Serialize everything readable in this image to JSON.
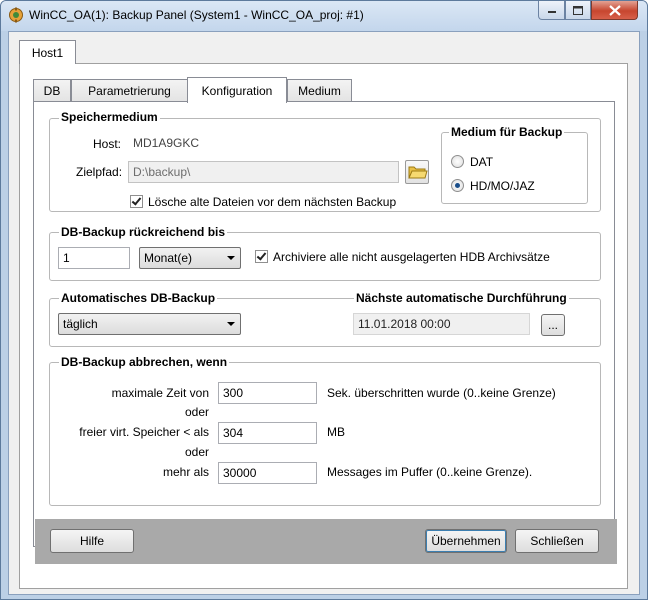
{
  "window": {
    "title": "WinCC_OA(1): Backup Panel (System1 - WinCC_OA_proj: #1)"
  },
  "host_tab": {
    "label": "Host1"
  },
  "tabs": [
    {
      "label": "DB"
    },
    {
      "label": "Parametrierung"
    },
    {
      "label": "Konfiguration"
    },
    {
      "label": "Medium"
    }
  ],
  "speichermedium": {
    "legend": "Speichermedium",
    "host_label": "Host:",
    "host_value": "MD1A9GKC",
    "zielpfad_label": "Zielpfad:",
    "zielpfad_value": "D:\\backup\\",
    "delete_old_label": "Lösche alte Dateien vor dem nächsten Backup",
    "delete_old_checked": true
  },
  "medium_backup": {
    "legend": "Medium für Backup",
    "options": [
      {
        "label": "DAT",
        "selected": false
      },
      {
        "label": "HD/MO/JAZ",
        "selected": true
      }
    ]
  },
  "db_rueck": {
    "legend": "DB-Backup rückreichend bis",
    "amount": "1",
    "unit": "Monat(e)",
    "archive_label": "Archiviere alle nicht ausgelagerten HDB Archivsätze",
    "archive_checked": true
  },
  "auto_backup": {
    "legend": "Automatisches DB-Backup",
    "interval": "täglich"
  },
  "next_run": {
    "legend": "Nächste automatische Durchführung",
    "value": "11.01.2018 00:00",
    "browse_label": "..."
  },
  "abort": {
    "legend": "DB-Backup abbrechen, wenn",
    "rows": [
      {
        "label": "maximale Zeit von",
        "value": "300",
        "suffix": "Sek. überschritten wurde (0..keine Grenze)"
      },
      {
        "label": "freier virt. Speicher < als",
        "value": "304",
        "suffix": "MB"
      },
      {
        "label": "mehr als",
        "value": "30000",
        "suffix": "Messages im Puffer (0..keine Grenze)."
      }
    ],
    "or_label": "oder"
  },
  "buttons": {
    "help": "Hilfe",
    "apply": "Übernehmen",
    "close": "Schließen"
  }
}
